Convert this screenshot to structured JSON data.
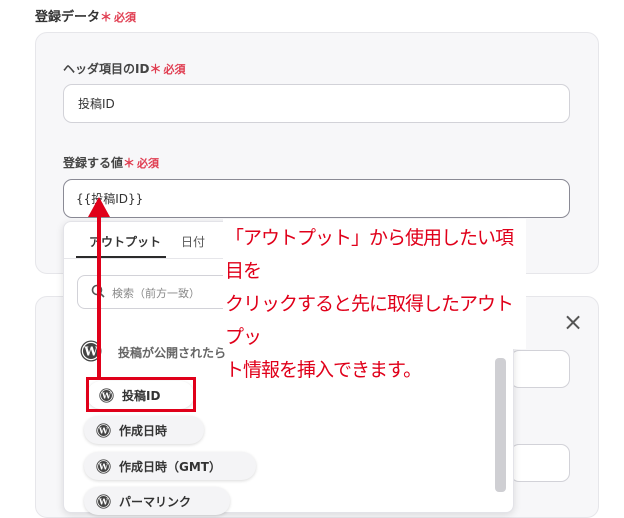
{
  "section": {
    "label": "登録データ",
    "required_star": "＊",
    "required_text": "必須"
  },
  "fields": [
    {
      "label": "ヘッダ項目のID",
      "value": "投稿ID"
    },
    {
      "label": "登録する値",
      "value": "{{投稿ID}}"
    }
  ],
  "close_label": "×",
  "dropdown": {
    "tabs": [
      "アウトプット",
      "日付"
    ],
    "active_tab": "アウトプット",
    "search_placeholder": "検索（前方一致）",
    "group_label": "投稿が公開されたら",
    "items": [
      "投稿ID",
      "作成日時",
      "作成日時（GMT）",
      "パーマリンク"
    ]
  },
  "annotation": {
    "lines": [
      "「アウトプット」から使用したい項目を",
      "クリックすると先に取得したアウトプッ",
      "ト情報を挿入できます。"
    ]
  },
  "colors": {
    "accent_red": "#e0001a",
    "required": "#e03c50",
    "card_bg": "#f7f7f9"
  }
}
